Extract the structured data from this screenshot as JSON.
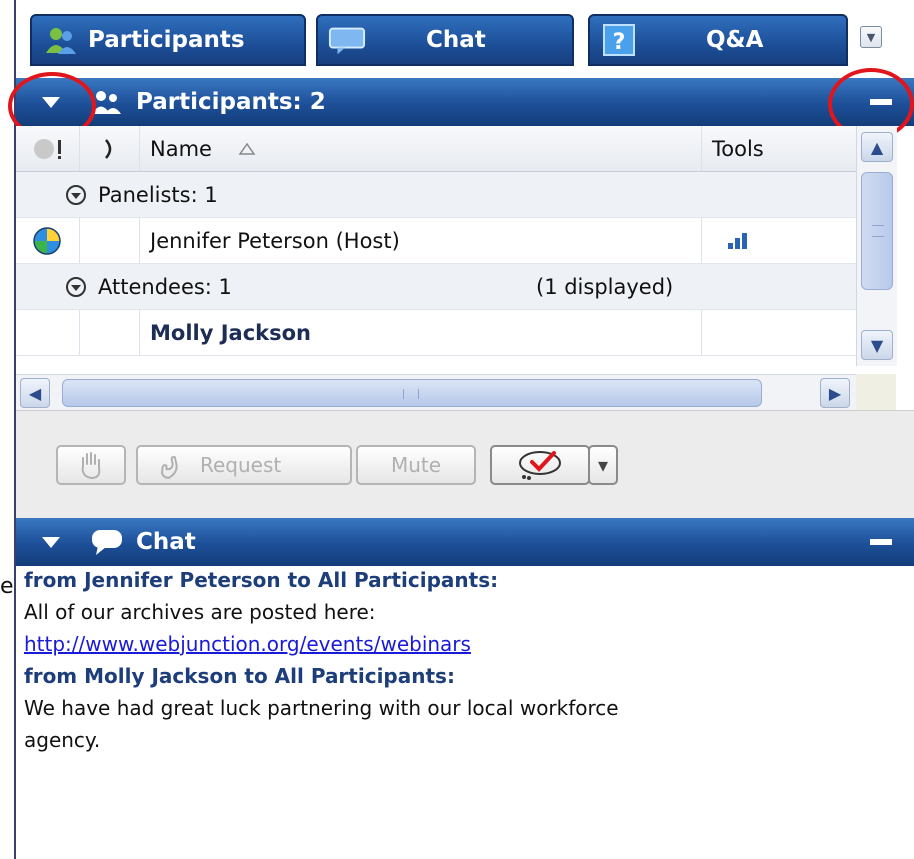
{
  "edge_text": "e",
  "tabs": {
    "participants": "Participants",
    "chat": "Chat",
    "qa": "Q&A"
  },
  "participants_panel": {
    "title": "Participants: 2",
    "columns": {
      "name": "Name",
      "tools": "Tools"
    },
    "panelists_group": "Panelists: 1",
    "panelist_name": "Jennifer Peterson (Host)",
    "attendees_group": "Attendees: 1",
    "attendees_displayed": "(1 displayed)",
    "attendee_name": "Molly Jackson"
  },
  "toolbar": {
    "request_label": "Request",
    "mute_label": "Mute"
  },
  "chat_panel": {
    "title": "Chat",
    "messages": [
      {
        "sender": "from Jennifer Peterson to All Participants:",
        "lines": [
          "All of our archives are posted here:"
        ],
        "link": "http://www.webjunction.org/events/webinars"
      },
      {
        "sender": "from Molly Jackson to All Participants:",
        "lines": [
          "We have had great luck partnering with our local workforce",
          "agency."
        ]
      }
    ]
  },
  "colors": {
    "header_blue": "#1d4f98",
    "highlight_ring": "#e0161c",
    "link": "#1a1adb"
  },
  "icons": [
    "participants-icon",
    "chat-bubble-icon",
    "help-icon",
    "panel-menu-icon",
    "collapse-triangle-icon",
    "minimize-icon",
    "sort-asc-icon",
    "globe-status-icon",
    "signal-bars-icon",
    "raise-hand-icon",
    "phone-icon",
    "feedback-check-icon"
  ]
}
